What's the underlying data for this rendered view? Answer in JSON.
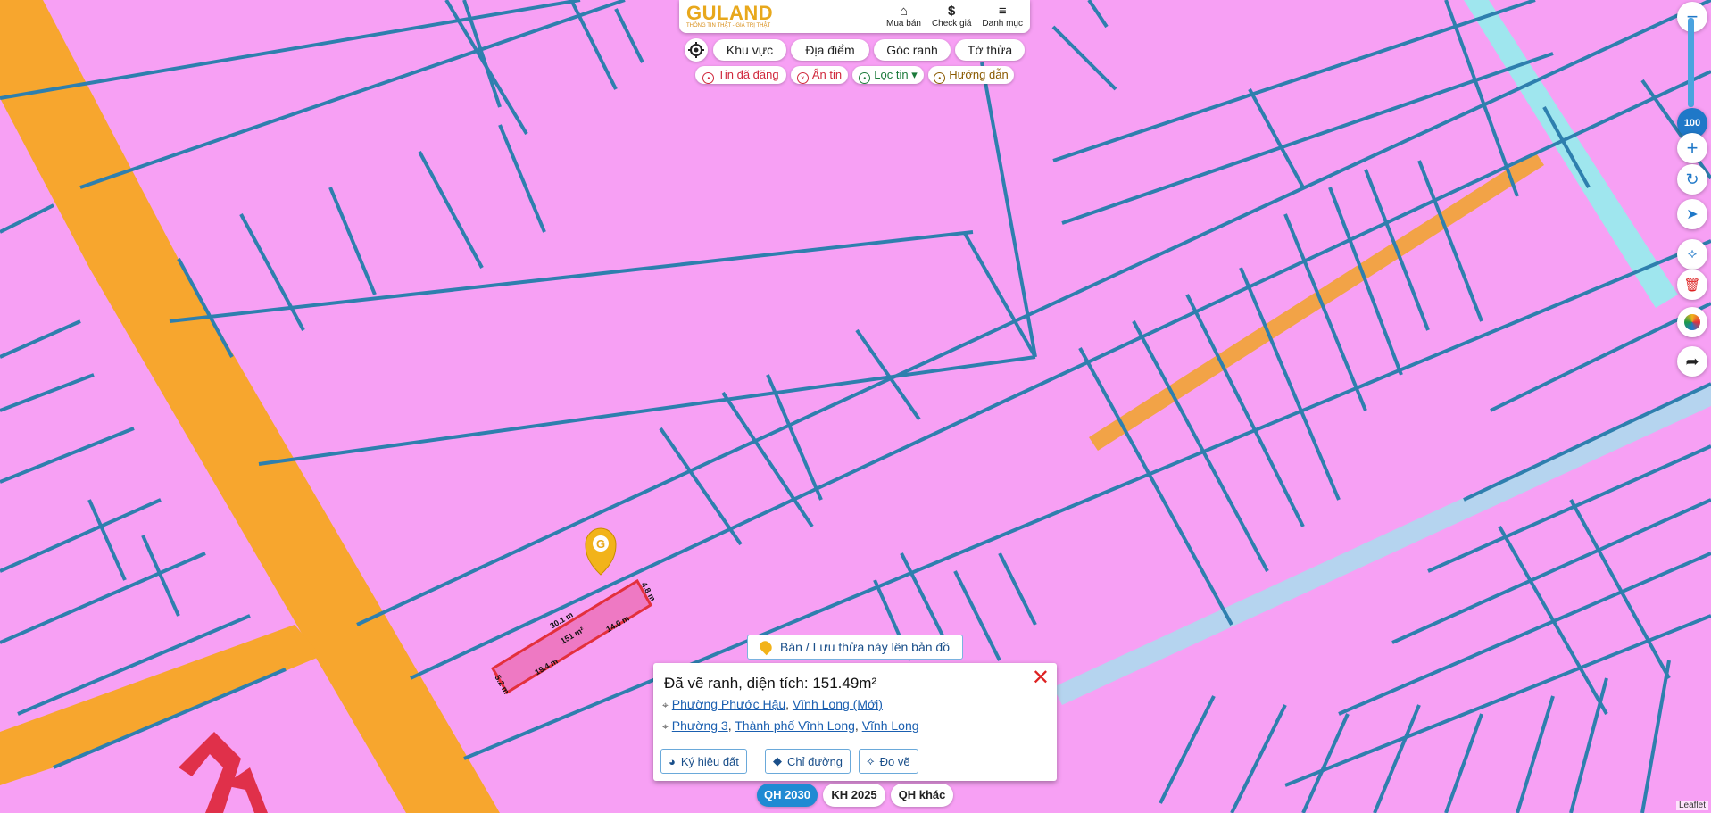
{
  "header": {
    "logo": "GULAND",
    "tagline": "THÔNG TIN THẬT - GIÁ TRỊ THẬT",
    "buttons": [
      {
        "label": "Mua bán",
        "icon": "house-icon"
      },
      {
        "label": "Check giá",
        "icon": "dollar-icon"
      },
      {
        "label": "Danh mục",
        "icon": "menu-icon"
      }
    ]
  },
  "search_tabs": [
    "Khu vực",
    "Địa điểm",
    "Góc ranh",
    "Tờ thửa"
  ],
  "filter_chips": [
    {
      "label": "Tin đã đăng",
      "color": "#d0283c"
    },
    {
      "label": "Ẩn tin",
      "color": "#d0283c"
    },
    {
      "label": "Lọc tin",
      "color": "#1b7a3a"
    },
    {
      "label": "Hướng dẫn",
      "color": "#8a5a00"
    }
  ],
  "zoom": {
    "level": "100"
  },
  "parcel": {
    "area_label": "151 m²",
    "edges": [
      "30.1 m",
      "4.8 m",
      "14.0 m",
      "19.4 m",
      "5.2 m"
    ]
  },
  "sell_button": "Bán / Lưu thửa này lên bản đồ",
  "popup": {
    "title": "Đã vẽ ranh, diện tích: 151.49m²",
    "address_new": [
      "Phường Phước Hậu",
      "Vĩnh Long (Mới)"
    ],
    "address_old": [
      "Phường 3",
      "Thành phố Vĩnh Long",
      "Vĩnh Long"
    ],
    "buttons": [
      "Ký hiệu đất",
      "Chỉ đường",
      "Đo vẽ"
    ]
  },
  "layer_tabs": [
    {
      "label": "QH 2030",
      "active": true
    },
    {
      "label": "KH 2025",
      "active": false
    },
    {
      "label": "QH khác",
      "active": false
    }
  ],
  "attribution": "Leaflet",
  "colors": {
    "residential": "#f7a0f4",
    "road": "#f7a62e",
    "parcel_line": "#2e7fae",
    "water": "#9fe6ee",
    "parcel_highlight": "#e3303c",
    "active_tab": "#1f8ad3"
  }
}
